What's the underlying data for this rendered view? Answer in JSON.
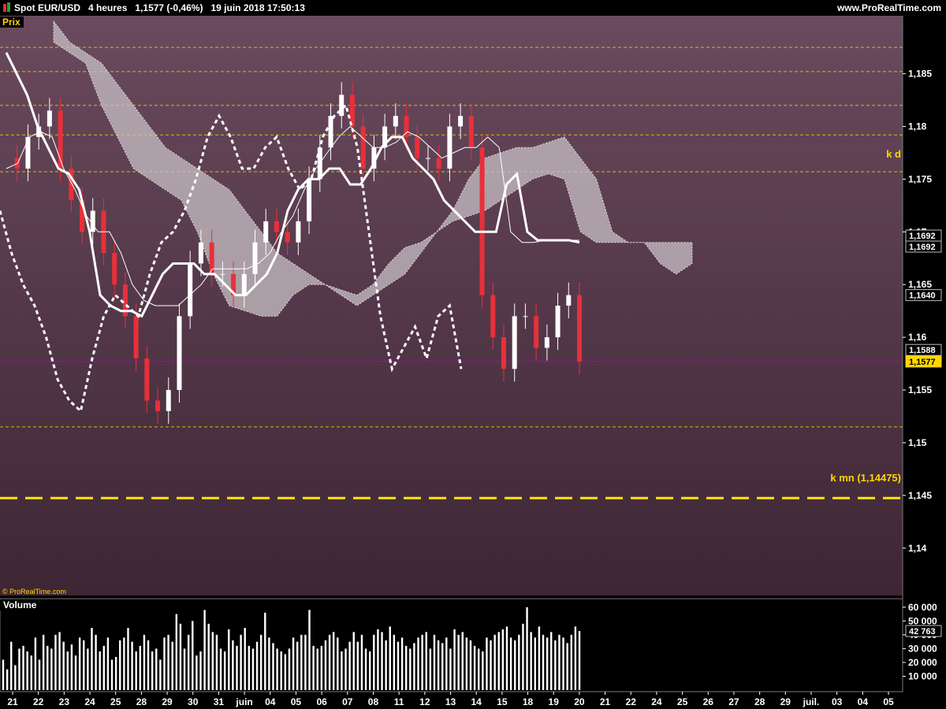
{
  "header": {
    "instrument": "Spot EUR/USD",
    "timeframe": "4 heures",
    "last": "1,1577 (-0,46%)",
    "datetime": "19 juin 2018 17:50:13",
    "website": "www.ProRealTime.com"
  },
  "price_panel": {
    "label": "Prix",
    "copyright": "© ProRealTime.com"
  },
  "volume_panel": {
    "label": "Volume"
  },
  "annotations": {
    "kd": "k d",
    "kmn": "k mn (1,14475)"
  },
  "chart_data": [
    {
      "type": "candlestick",
      "title": "Spot EUR/USD 4 heures",
      "ylim": [
        1.1355,
        1.1905
      ],
      "y_ticks": [
        "1,14",
        "1,145",
        "1,15",
        "1,155",
        "1,16",
        "1,165",
        "1,17",
        "1,175",
        "1,18",
        "1,185"
      ],
      "x_ticks": [
        "21",
        "22",
        "23",
        "24",
        "25",
        "28",
        "29",
        "30",
        "31",
        "juin",
        "04",
        "05",
        "06",
        "07",
        "08",
        "11",
        "12",
        "13",
        "14",
        "15",
        "18",
        "19",
        "20",
        "21",
        "22",
        "24",
        "25",
        "26",
        "27",
        "28",
        "29",
        "juil.",
        "03",
        "04",
        "05"
      ],
      "price_badges": [
        {
          "label": "1,1692",
          "value": 1.1692
        },
        {
          "label": "1,1692",
          "value": 1.1692
        },
        {
          "label": "1,1640",
          "value": 1.164
        },
        {
          "label": "1,1588",
          "value": 1.1588
        },
        {
          "label": "1,1577",
          "value": 1.1577,
          "current": true
        }
      ],
      "horizontal_levels": [
        1.1875,
        1.1852,
        1.182,
        1.1792,
        1.1757,
        1.1515
      ],
      "kd_level": 1.1755,
      "kmn_level": 1.14475,
      "current_price": 1.1577,
      "series": [
        {
          "name": "price",
          "values": [
            1.177,
            1.176,
            1.179,
            1.18,
            1.1815,
            1.176,
            1.173,
            1.17,
            1.172,
            1.168,
            1.165,
            1.162,
            1.158,
            1.154,
            1.153,
            1.155,
            1.162,
            1.167,
            1.169,
            1.166,
            1.166,
            1.164,
            1.166,
            1.169,
            1.171,
            1.17,
            1.169,
            1.171,
            1.175,
            1.178,
            1.181,
            1.183,
            1.18,
            1.176,
            1.178,
            1.18,
            1.181,
            1.179,
            1.177,
            1.177,
            1.176,
            1.18,
            1.181,
            1.178,
            1.164,
            1.16,
            1.157,
            1.162,
            1.162,
            1.159,
            1.16,
            1.163,
            1.164,
            1.1577
          ]
        },
        {
          "name": "tenkan",
          "values": [
            1.176,
            1.1765,
            1.179,
            1.1795,
            1.179,
            1.176,
            1.174,
            1.1715,
            1.17,
            1.17,
            1.168,
            1.165,
            1.1635,
            1.163,
            1.163,
            1.163,
            1.164,
            1.165,
            1.1665,
            1.1665,
            1.1665,
            1.1665,
            1.167,
            1.168,
            1.17,
            1.1715,
            1.174,
            1.176,
            1.1775,
            1.179,
            1.18,
            1.179,
            1.178,
            1.178,
            1.1785,
            1.1795,
            1.179,
            1.178,
            1.177,
            1.1775,
            1.178,
            1.178,
            1.179,
            1.178,
            1.17,
            1.169,
            1.169,
            1.1692,
            1.1692,
            1.1692,
            1.1692
          ]
        },
        {
          "name": "kijun",
          "values": [
            1.187,
            1.185,
            1.183,
            1.18,
            1.178,
            1.176,
            1.1755,
            1.174,
            1.17,
            1.164,
            1.163,
            1.1625,
            1.1625,
            1.162,
            1.164,
            1.166,
            1.167,
            1.167,
            1.167,
            1.166,
            1.166,
            1.165,
            1.164,
            1.164,
            1.165,
            1.166,
            1.168,
            1.172,
            1.174,
            1.175,
            1.175,
            1.176,
            1.176,
            1.1745,
            1.1745,
            1.176,
            1.178,
            1.179,
            1.179,
            1.177,
            1.176,
            1.175,
            1.173,
            1.172,
            1.171,
            1.17,
            1.17,
            1.17,
            1.1745,
            1.1755,
            1.17,
            1.1692,
            1.1692,
            1.1692,
            1.1692,
            1.169
          ]
        },
        {
          "name": "chikou",
          "values": [
            1.172,
            1.168,
            1.165,
            1.163,
            1.16,
            1.156,
            1.154,
            1.153,
            1.158,
            1.162,
            1.164,
            1.163,
            1.162,
            1.166,
            1.169,
            1.17,
            1.172,
            1.175,
            1.179,
            1.181,
            1.179,
            1.176,
            1.176,
            1.178,
            1.179,
            1.176,
            1.174,
            1.175,
            1.179,
            1.181,
            1.182,
            1.178,
            1.17,
            1.162,
            1.157,
            1.159,
            1.161,
            1.158,
            1.162,
            1.163,
            1.157
          ]
        },
        {
          "name": "span_a",
          "values": [
            1.19,
            1.188,
            1.187,
            1.186,
            1.184,
            1.182,
            1.18,
            1.178,
            1.177,
            1.176,
            1.175,
            1.174,
            1.172,
            1.17,
            1.168,
            1.167,
            1.166,
            1.165,
            1.164,
            1.163,
            1.164,
            1.165,
            1.166,
            1.168,
            1.17,
            1.172,
            1.175,
            1.177,
            1.1775,
            1.178,
            1.178,
            1.1785,
            1.179,
            1.177,
            1.175,
            1.17,
            1.169,
            1.169,
            1.167,
            1.166,
            1.167
          ]
        },
        {
          "name": "span_b",
          "values": [
            1.188,
            1.187,
            1.186,
            1.182,
            1.179,
            1.176,
            1.175,
            1.174,
            1.173,
            1.17,
            1.166,
            1.163,
            1.1625,
            1.162,
            1.162,
            1.164,
            1.165,
            1.165,
            1.1645,
            1.164,
            1.165,
            1.167,
            1.1685,
            1.169,
            1.17,
            1.171,
            1.1715,
            1.172,
            1.173,
            1.174,
            1.175,
            1.1755,
            1.175,
            1.17,
            1.169,
            1.169,
            1.169,
            1.169,
            1.169,
            1.169,
            1.169
          ]
        }
      ]
    },
    {
      "type": "bar",
      "title": "Volume",
      "ylim": [
        0,
        65000
      ],
      "y_ticks": [
        "10 000",
        "20 000",
        "30 000",
        "40 000",
        "50 000",
        "60 000"
      ],
      "current_volume": {
        "label": "42 763",
        "value": 42763
      },
      "values": [
        22000,
        15000,
        35000,
        18000,
        30000,
        32000,
        28000,
        25000,
        38000,
        22000,
        40000,
        32000,
        30000,
        40000,
        42000,
        35000,
        28000,
        33000,
        25000,
        38000,
        36000,
        30000,
        45000,
        40000,
        28000,
        32000,
        38000,
        22000,
        24000,
        36000,
        38000,
        45000,
        35000,
        28000,
        32000,
        40000,
        36000,
        28000,
        30000,
        22000,
        38000,
        40000,
        35000,
        55000,
        48000,
        30000,
        40000,
        50000,
        25000,
        28000,
        58000,
        48000,
        42000,
        40000,
        30000,
        28000,
        44000,
        36000,
        32000,
        40000,
        45000,
        32000,
        30000,
        35000,
        40000,
        56000,
        38000,
        34000,
        30000,
        28000,
        26000,
        30000,
        38000,
        35000,
        40000,
        40000,
        58000,
        32000,
        30000,
        32000,
        36000,
        40000,
        42000,
        38000,
        28000,
        30000,
        35000,
        42000,
        35000,
        40000,
        30000,
        28000,
        40000,
        44000,
        42000,
        36000,
        46000,
        40000,
        35000,
        38000,
        32000,
        30000,
        34000,
        38000,
        40000,
        42000,
        30000,
        40000,
        36000,
        34000,
        38000,
        30000,
        44000,
        40000,
        42000,
        38000,
        36000,
        32000,
        30000,
        28000,
        38000,
        36000,
        40000,
        42000,
        44000,
        46000,
        38000,
        36000,
        40000,
        48000,
        60000,
        42000,
        38000,
        46000,
        40000,
        38000,
        42000,
        36000,
        40000,
        38000,
        34000,
        40000,
        46000,
        42763
      ]
    }
  ]
}
